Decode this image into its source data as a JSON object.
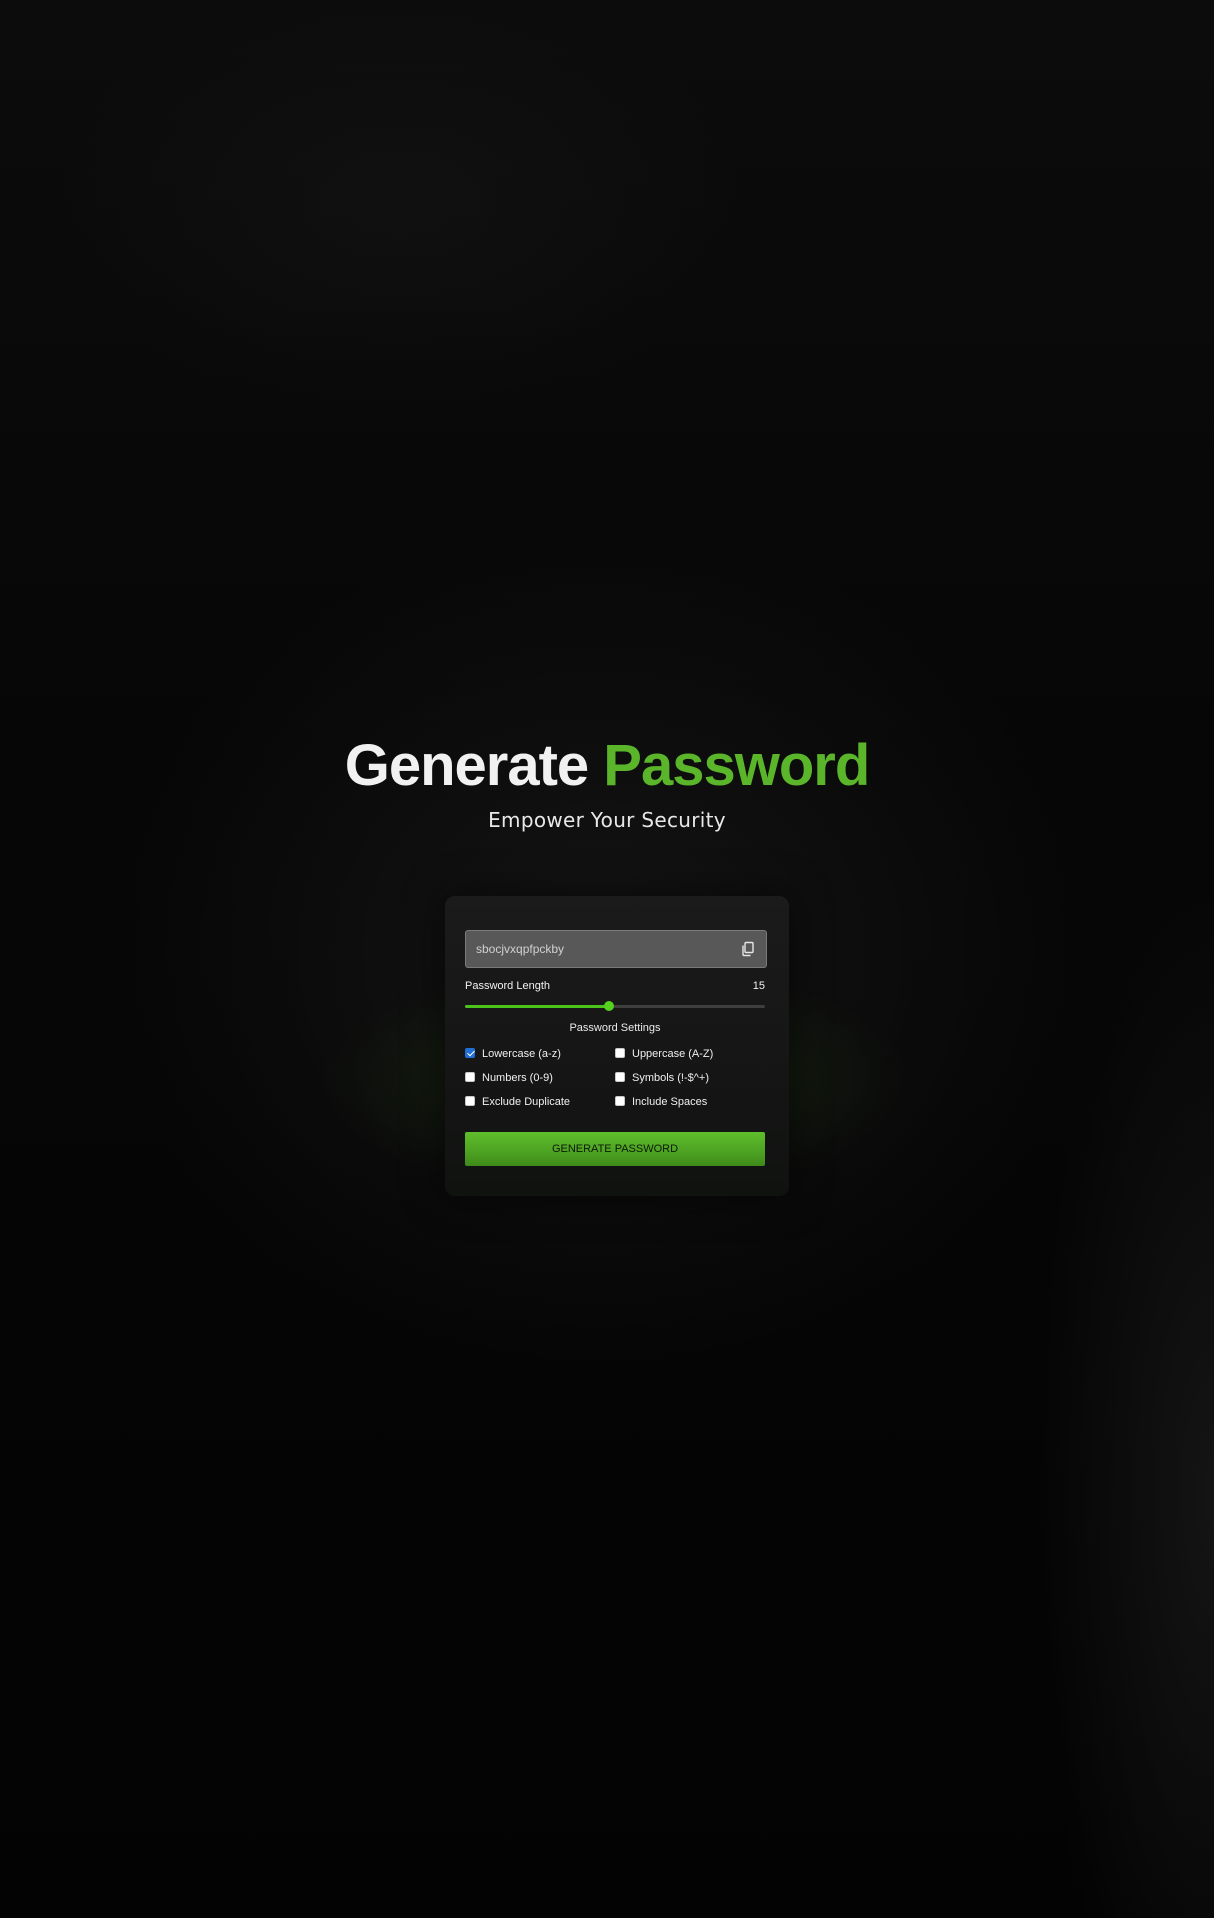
{
  "colors": {
    "accent": "#5bb52a",
    "background": "#030303",
    "card": "#1b1b1b",
    "checkbox_checked": "#1f6fd6"
  },
  "hero": {
    "title_part1": "Generate",
    "title_part2": "Password",
    "subtitle": "Empower Your Security"
  },
  "generator": {
    "password_value": "sbocjvxqpfpckby",
    "copy_icon": "copy-icon",
    "length_label": "Password Length",
    "length_value": "15",
    "length_slider_fraction": 0.48,
    "settings_title": "Password Settings",
    "options": [
      {
        "label": "Lowercase (a-z)",
        "checked": true
      },
      {
        "label": "Uppercase (A-Z)",
        "checked": false
      },
      {
        "label": "Numbers (0-9)",
        "checked": false
      },
      {
        "label": "Symbols (!-$^+)",
        "checked": false
      },
      {
        "label": "Exclude Duplicate",
        "checked": false
      },
      {
        "label": "Include Spaces",
        "checked": false
      }
    ],
    "generate_button_label": "GENERATE PASSWORD"
  }
}
